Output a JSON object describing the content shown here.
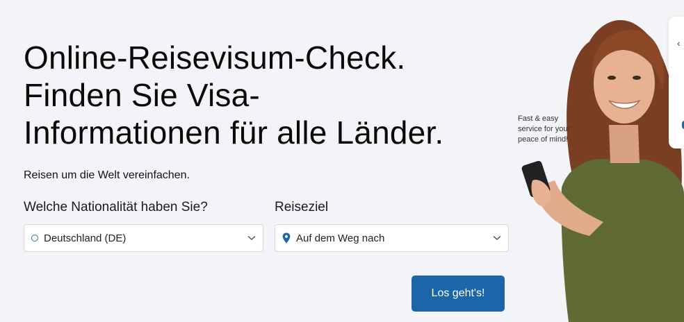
{
  "hero": {
    "title_lines": [
      "Online-Reisevisum-Check.",
      "Finden Sie Visa-",
      "Informationen für alle Länder."
    ],
    "subtitle": "Reisen um die Welt vereinfachen."
  },
  "form": {
    "nationality_label": "Welche Nationalität haben Sie?",
    "nationality_value": "Deutschland (DE)",
    "destination_label": "Reiseziel",
    "destination_value": "Auf dem Weg nach",
    "submit_label": "Los geht's!"
  },
  "promo": {
    "bubble_line1": "Fast & easy",
    "bubble_line2": "service for your",
    "bubble_line3": "peace of mind!"
  },
  "colors": {
    "accent": "#1a66a8",
    "background": "#f3f4f8"
  },
  "icons": {
    "nationality": "radio-circle-icon",
    "destination": "map-pin-icon",
    "dropdown": "chevron-down-icon",
    "back": "chevron-left-icon"
  }
}
